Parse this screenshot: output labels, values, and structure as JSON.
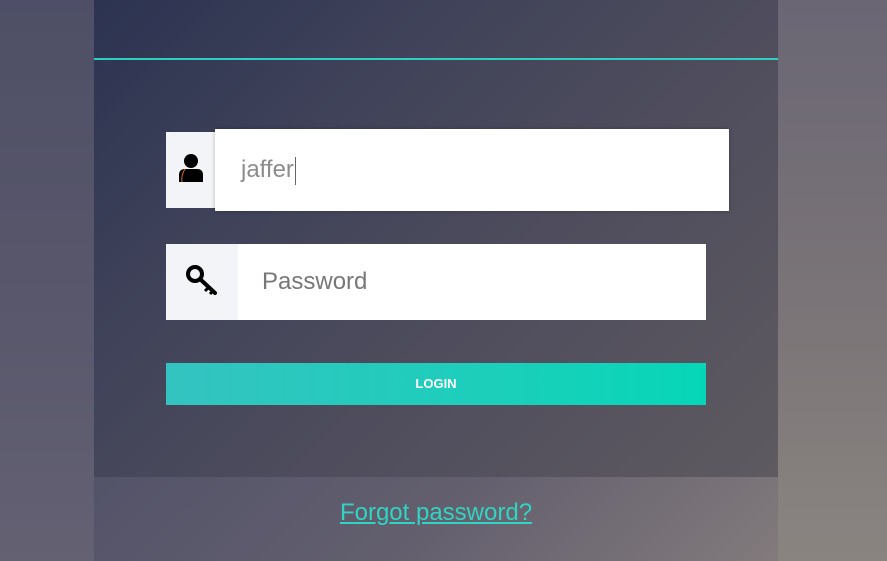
{
  "login_form": {
    "username": {
      "value": "jaffer",
      "icon": "user-icon"
    },
    "password": {
      "placeholder": "Password",
      "icon": "key-icon"
    },
    "login_label": "LOGIN"
  },
  "footer": {
    "forgot_password_label": "Forgot password?"
  },
  "colors": {
    "accent": "#2ecfbf",
    "button_start": "#34c3c0",
    "button_end": "#06d6b8"
  }
}
